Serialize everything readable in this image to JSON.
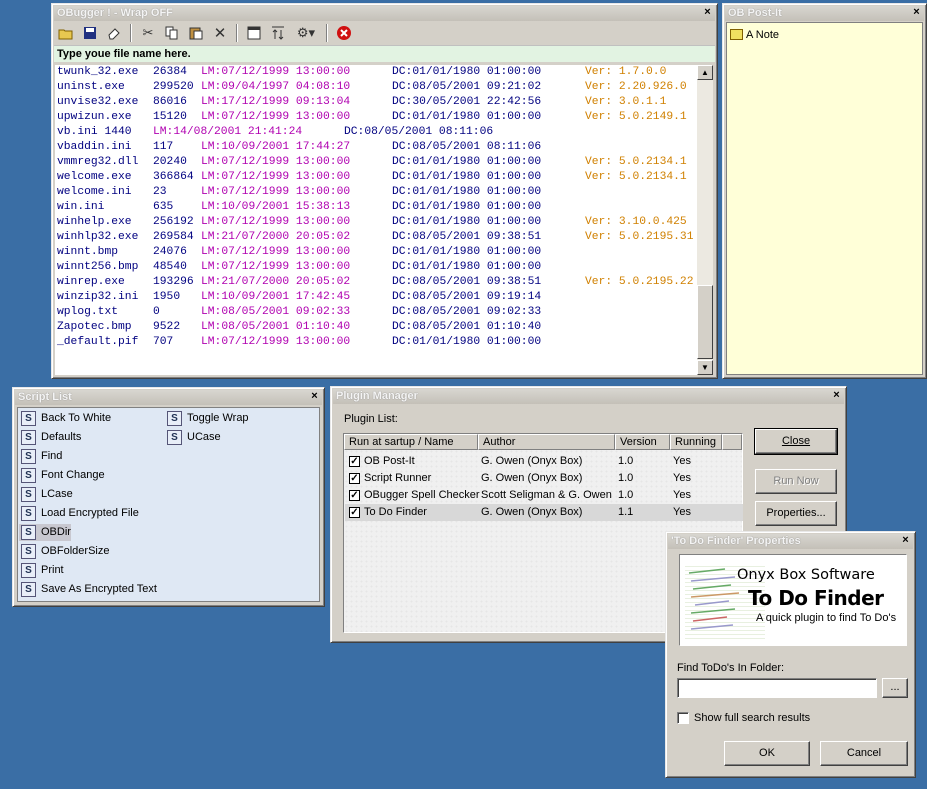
{
  "obugger": {
    "title": "OBugger ! - Wrap OFF",
    "close": "×",
    "filename_prompt": "Type youe file name here.",
    "toolbar_icons": [
      "open-icon",
      "save-icon",
      "eraser-icon",
      "cut-icon",
      "copy-icon",
      "paste-icon",
      "delete-icon",
      "window-icon",
      "sort-icon",
      "plugin-icon",
      "stop-icon"
    ],
    "lines": [
      {
        "name": "twunk_32.exe",
        "size": "26384",
        "lm": "LM:07/12/1999 13:00:00",
        "dc": "DC:01/01/1980 01:00:00",
        "ver": "Ver: 1.7.0.0"
      },
      {
        "name": "uninst.exe",
        "size": "299520",
        "lm": "LM:09/04/1997 04:08:10",
        "dc": "DC:08/05/2001 09:21:02",
        "ver": "Ver: 2.20.926.0"
      },
      {
        "name": "unvise32.exe",
        "size": "86016",
        "lm": "LM:17/12/1999 09:13:04",
        "dc": "DC:30/05/2001 22:42:56",
        "ver": "Ver: 3.0.1.1"
      },
      {
        "name": "upwizun.exe",
        "size": "15120",
        "lm": "LM:07/12/1999 13:00:00",
        "dc": "DC:01/01/1980 01:00:00",
        "ver": "Ver: 5.0.2149.1"
      },
      {
        "name": "vb.ini 1440",
        "size": "",
        "lm": "LM:14/08/2001 21:41:24",
        "dc": "DC:08/05/2001 08:11:06",
        "ver": "",
        "short": true
      },
      {
        "name": "vbaddin.ini",
        "size": "117",
        "lm": "LM:10/09/2001 17:44:27",
        "dc": "DC:08/05/2001 08:11:06",
        "ver": ""
      },
      {
        "name": "vmmreg32.dll",
        "size": "20240",
        "lm": "LM:07/12/1999 13:00:00",
        "dc": "DC:01/01/1980 01:00:00",
        "ver": "Ver: 5.0.2134.1"
      },
      {
        "name": "welcome.exe",
        "size": "366864",
        "lm": "LM:07/12/1999 13:00:00",
        "dc": "DC:01/01/1980 01:00:00",
        "ver": "Ver: 5.0.2134.1"
      },
      {
        "name": "welcome.ini",
        "size": "23",
        "lm": "LM:07/12/1999 13:00:00",
        "dc": "DC:01/01/1980 01:00:00",
        "ver": ""
      },
      {
        "name": "win.ini",
        "size": "635",
        "lm": "LM:10/09/2001 15:38:13",
        "dc": "DC:01/01/1980 01:00:00",
        "ver": ""
      },
      {
        "name": "winhelp.exe",
        "size": "256192",
        "lm": "LM:07/12/1999 13:00:00",
        "dc": "DC:01/01/1980 01:00:00",
        "ver": "Ver: 3.10.0.425"
      },
      {
        "name": "winhlp32.exe",
        "size": "269584",
        "lm": "LM:21/07/2000 20:05:02",
        "dc": "DC:08/05/2001 09:38:51",
        "ver": "Ver: 5.0.2195.31"
      },
      {
        "name": "winnt.bmp",
        "size": "24076",
        "lm": "LM:07/12/1999 13:00:00",
        "dc": "DC:01/01/1980 01:00:00",
        "ver": ""
      },
      {
        "name": "winnt256.bmp",
        "size": "48540",
        "lm": "LM:07/12/1999 13:00:00",
        "dc": "DC:01/01/1980 01:00:00",
        "ver": ""
      },
      {
        "name": "winrep.exe",
        "size": "193296",
        "lm": "LM:21/07/2000 20:05:02",
        "dc": "DC:08/05/2001 09:38:51",
        "ver": "Ver: 5.0.2195.22"
      },
      {
        "name": "winzip32.ini",
        "size": "1950",
        "lm": "LM:10/09/2001 17:42:45",
        "dc": "DC:08/05/2001 09:19:14",
        "ver": ""
      },
      {
        "name": "wplog.txt",
        "size": "0",
        "lm": "LM:08/05/2001 09:02:33",
        "dc": "DC:08/05/2001 09:02:33",
        "ver": ""
      },
      {
        "name": "Zapotec.bmp",
        "size": "9522",
        "lm": "LM:08/05/2001 01:10:40",
        "dc": "DC:08/05/2001 01:10:40",
        "ver": ""
      },
      {
        "name": "_default.pif",
        "size": "707",
        "lm": "LM:07/12/1999 13:00:00",
        "dc": "DC:01/01/1980 01:00:00",
        "ver": ""
      }
    ]
  },
  "postit": {
    "title": "OB Post-It",
    "close": "×",
    "note": "A Note"
  },
  "script_list": {
    "title": "Script List",
    "close": "×",
    "items": [
      "Back To White",
      "Defaults",
      "Find",
      "Font Change",
      "LCase",
      "Load Encrypted File",
      "OBDir",
      "OBFolderSize",
      "Print",
      "Save As Encrypted Text"
    ],
    "items_col2": [
      "Toggle Wrap",
      "UCase"
    ]
  },
  "plugin_manager": {
    "title": "Plugin Manager",
    "close": "×",
    "list_label": "Plugin List:",
    "columns": [
      "Run at sartup / Name",
      "Author",
      "Version",
      "Running"
    ],
    "rows": [
      {
        "name": "OB Post-It",
        "author": "G. Owen (Onyx Box)",
        "version": "1.0",
        "running": "Yes"
      },
      {
        "name": "Script Runner",
        "author": "G. Owen (Onyx Box)",
        "version": "1.0",
        "running": "Yes"
      },
      {
        "name": "OBugger Spell Checker",
        "author": "Scott Seligman & G. Owen",
        "version": "1.0",
        "running": "Yes"
      },
      {
        "name": "To Do Finder",
        "author": "G. Owen (Onyx Box)",
        "version": "1.1",
        "running": "Yes"
      }
    ],
    "close_button": "Close",
    "run_now_button": "Run Now",
    "properties_button": "Properties..."
  },
  "todo": {
    "title": "'To Do Finder' Properties",
    "close": "×",
    "company": "Onyx Box Software",
    "product": "To Do Finder",
    "tagline": "A quick plugin to find To Do's",
    "folder_label": "Find ToDo's In Folder:",
    "folder_value": "",
    "browse": "...",
    "show_full": "Show full search results",
    "ok": "OK",
    "cancel": "Cancel"
  },
  "colors": {
    "desktop": "#3a6ea5",
    "filebar": "#e2f3e2",
    "lm": "#b000b0",
    "names": "#000080",
    "version": "#d08000",
    "postit": "#ffffd8"
  }
}
